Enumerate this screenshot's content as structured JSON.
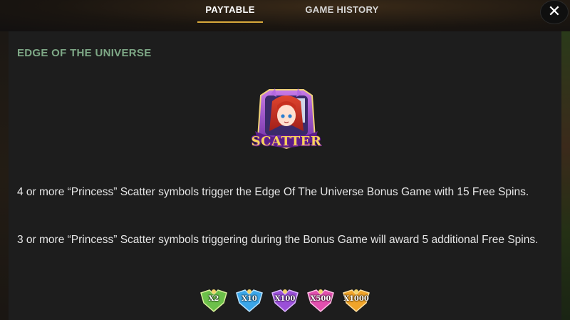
{
  "tabs": [
    {
      "label": "PAYTABLE",
      "active": true
    },
    {
      "label": "GAME HISTORY",
      "active": false
    }
  ],
  "close_icon": "close-icon",
  "section": {
    "title": "EDGE OF THE UNIVERSE",
    "symbol_label": "SCATTER",
    "paragraphs": [
      "4 or more “Princess” Scatter symbols trigger the Edge Of The Universe Bonus Game with 15 Free Spins.",
      "3 or more “Princess” Scatter symbols triggering during the Bonus Game will award 5 additional Free Spins."
    ]
  },
  "multipliers": [
    {
      "label": "X2",
      "color": "#6cc04a"
    },
    {
      "label": "X10",
      "color": "#3ba6e8"
    },
    {
      "label": "X100",
      "color": "#9a4fd8"
    },
    {
      "label": "X500",
      "color": "#e24fae"
    },
    {
      "label": "X1000",
      "color": "#f0a42a"
    }
  ],
  "colors": {
    "accent": "#d9a93b",
    "section_title": "#7ea886",
    "panel": "#1d1d1d"
  }
}
